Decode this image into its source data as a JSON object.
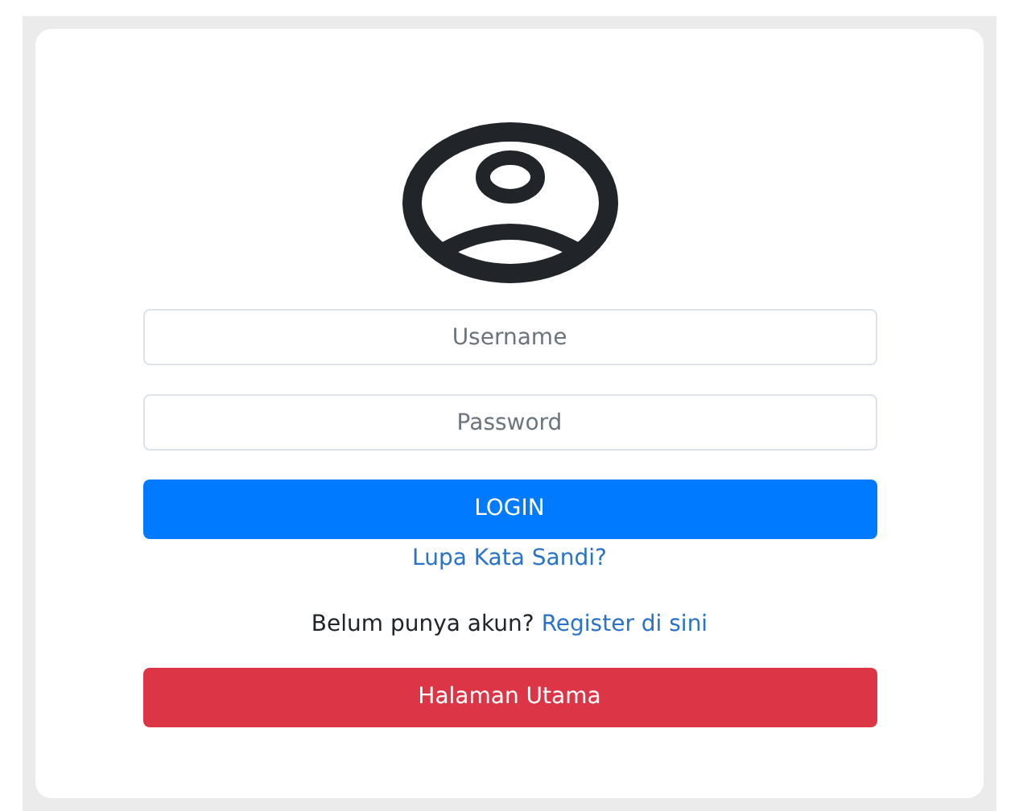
{
  "login_form": {
    "username": {
      "placeholder": "Username"
    },
    "password": {
      "placeholder": "Password"
    },
    "login_button": "LOGIN",
    "forgot_link": "Lupa Kata Sandi?",
    "register_prompt": {
      "text": "Belum punya akun?",
      "link": "Register di sini"
    },
    "home_button": "Halaman Utama"
  }
}
